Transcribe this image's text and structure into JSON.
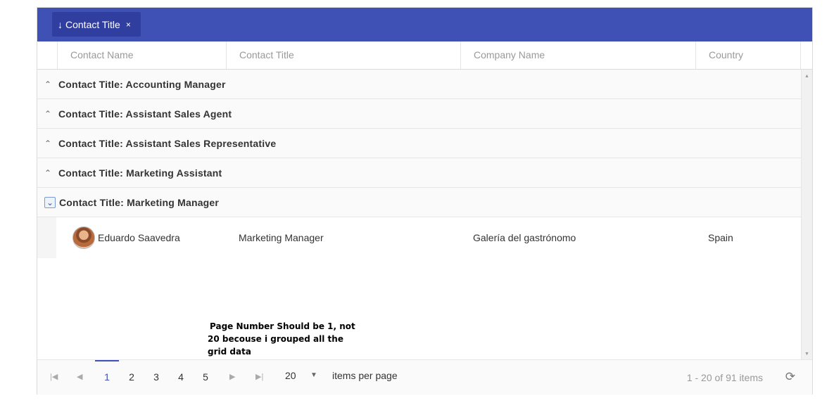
{
  "grouping": {
    "chip_arrow": "↓",
    "chip_label": "Contact Title",
    "chip_close": "×"
  },
  "columns": [
    "Contact Name",
    "Contact Title",
    "Company Name",
    "Country"
  ],
  "groups": [
    {
      "label": "Contact Title: Accounting Manager",
      "expanded": false
    },
    {
      "label": "Contact Title: Assistant Sales Agent",
      "expanded": false
    },
    {
      "label": "Contact Title: Assistant Sales Representative",
      "expanded": false
    },
    {
      "label": "Contact Title: Marketing Assistant",
      "expanded": false
    },
    {
      "label": "Contact Title: Marketing Manager",
      "expanded": true
    }
  ],
  "rows": [
    {
      "contact_name": "Eduardo Saavedra",
      "contact_title": "Marketing Manager",
      "company_name": "Galería del gastrónomo",
      "country": "Spain"
    }
  ],
  "annotation": {
    "line1": "Page Number Should be 1, not",
    "line2": "20 becouse i grouped all the",
    "line3": "grid data"
  },
  "pager": {
    "first_icon": "first-page-icon",
    "prev_icon": "previous-page-icon",
    "next_icon": "next-page-icon",
    "last_icon": "last-page-icon",
    "pages": [
      "1",
      "2",
      "3",
      "4",
      "5"
    ],
    "active_page": "1",
    "page_size": "20",
    "items_per_page_label": "items per page",
    "info": "1 - 20 of 91 items"
  },
  "colors": {
    "header": "#3f51b5",
    "chip": "#303f9f",
    "accent": "#3f51b5"
  }
}
